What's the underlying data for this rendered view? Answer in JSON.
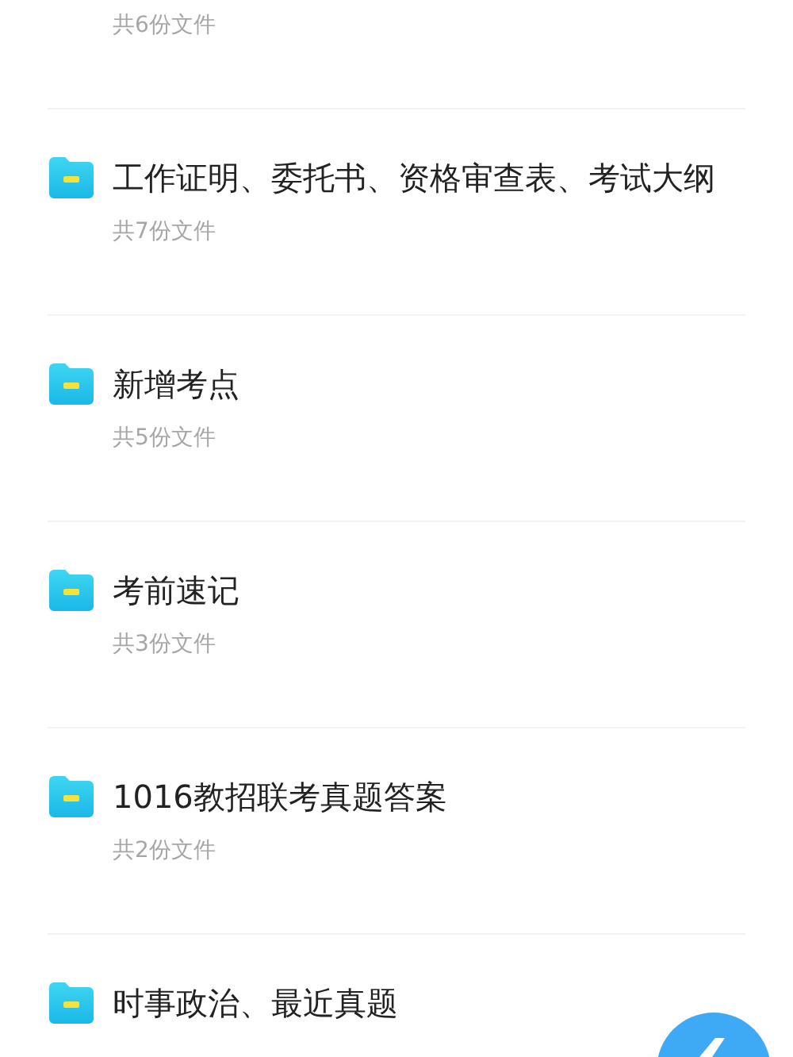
{
  "top_item": {
    "count": "共6份文件"
  },
  "folders": [
    {
      "title": "工作证明、委托书、资格审查表、考试大纲",
      "count": "共7份文件"
    },
    {
      "title": "新增考点",
      "count": "共5份文件"
    },
    {
      "title": "考前速记",
      "count": "共3份文件"
    },
    {
      "title": "1016教招联考真题答案",
      "count": "共2份文件"
    },
    {
      "title": "时事政治、最近真题"
    }
  ]
}
